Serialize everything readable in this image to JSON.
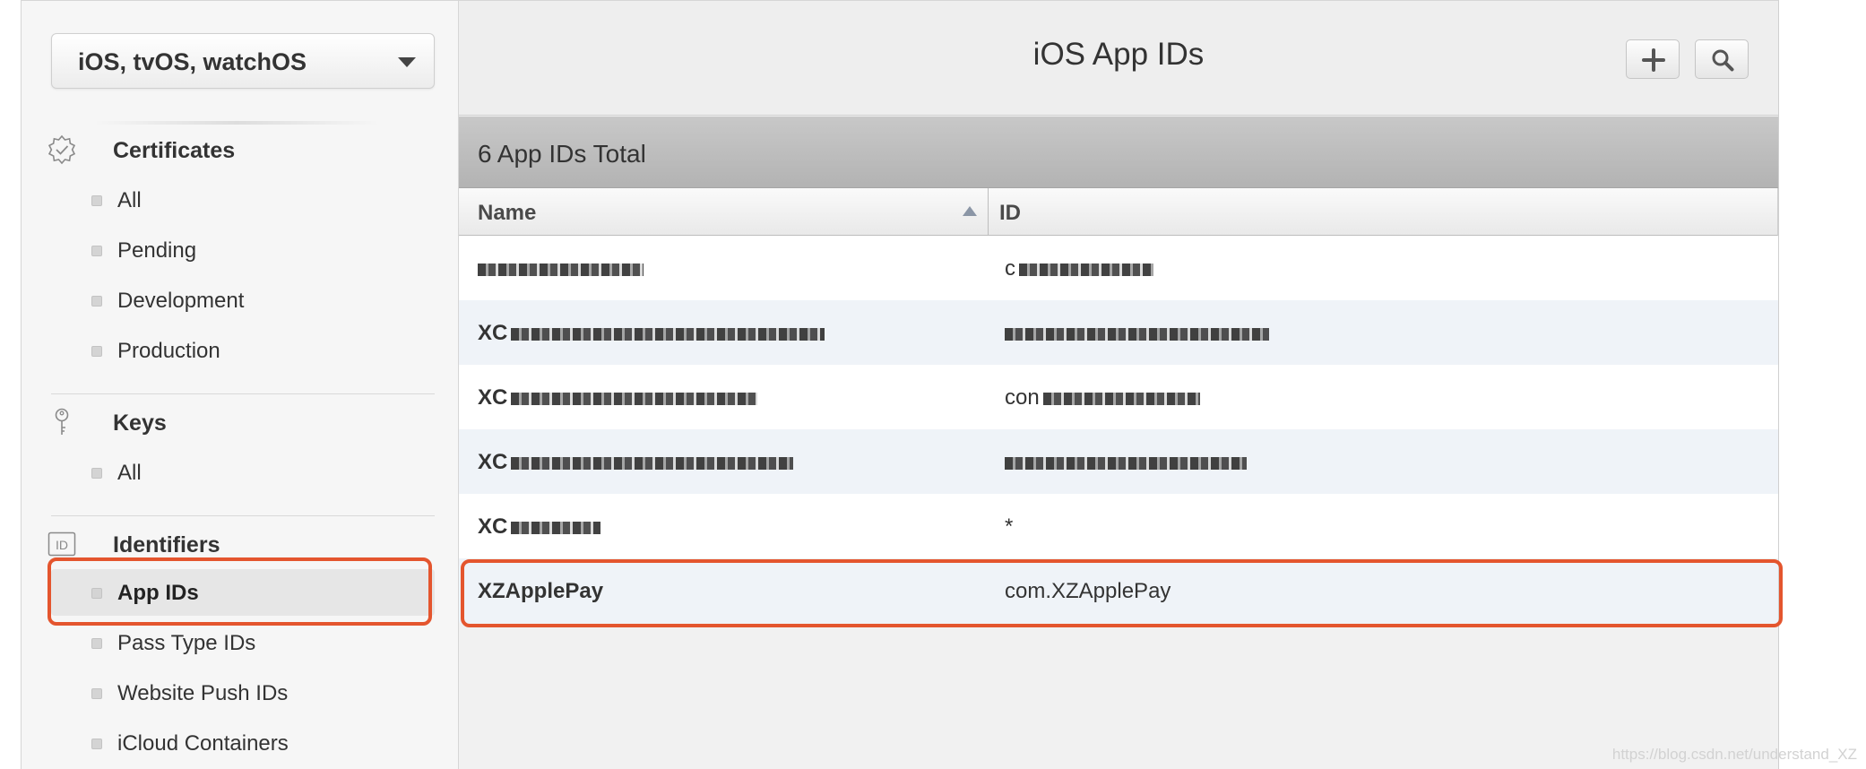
{
  "sidebar": {
    "platform_selector": "iOS, tvOS, watchOS",
    "sections": {
      "certificates": {
        "label": "Certificates",
        "icon": "certificate-badge-icon",
        "items": [
          "All",
          "Pending",
          "Development",
          "Production"
        ]
      },
      "keys": {
        "label": "Keys",
        "icon": "key-icon",
        "items": [
          "All"
        ]
      },
      "identifiers": {
        "label": "Identifiers",
        "icon": "id-icon",
        "icon_text": "ID",
        "items": [
          "App IDs",
          "Pass Type IDs",
          "Website Push IDs",
          "iCloud Containers"
        ],
        "active_item": "App IDs"
      }
    }
  },
  "main": {
    "title": "iOS App IDs",
    "actions": {
      "add_icon": "plus-icon",
      "search_icon": "search-icon"
    },
    "total": "6 App IDs Total",
    "columns": {
      "name": "Name",
      "id": "ID"
    },
    "rows": [
      {
        "name": "",
        "id": "c"
      },
      {
        "name": "XC",
        "id": ""
      },
      {
        "name": "XC",
        "id": "con"
      },
      {
        "name": "XC",
        "id": ""
      },
      {
        "name": "XC",
        "id": "*"
      },
      {
        "name": "XZApplePay",
        "id": "com.XZApplePay"
      }
    ],
    "highlighted_row": "XZApplePay"
  },
  "watermark": "https://blog.csdn.net/understand_XZ",
  "colors": {
    "highlight": "#e4552e",
    "stripe": "#eff3f8",
    "total_bar": "#b9b9b9"
  }
}
